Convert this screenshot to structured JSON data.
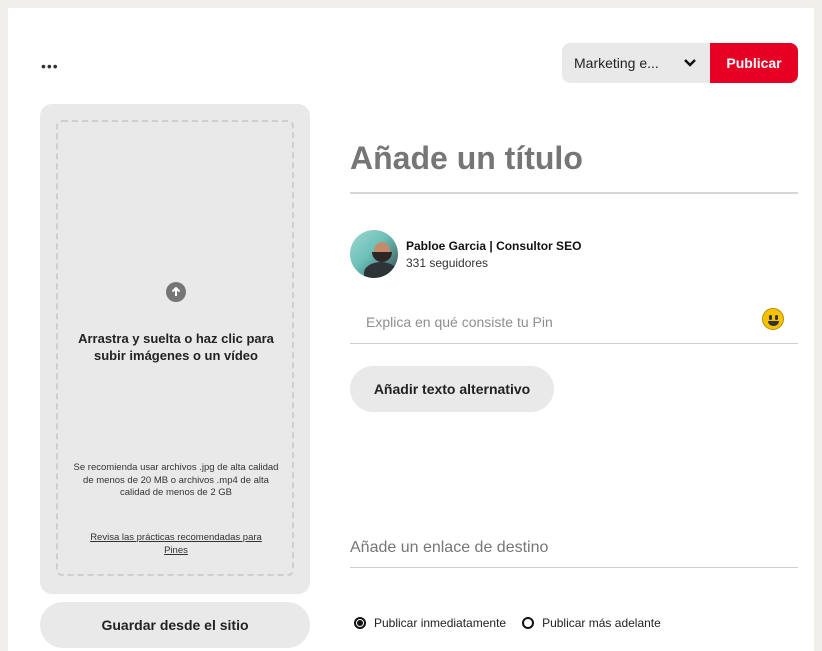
{
  "toolbar": {
    "more_label": "•••",
    "board_select": "Marketing e...",
    "publish_label": "Publicar",
    "publish_color": "#e60023"
  },
  "upload": {
    "icon": "arrow-up-icon",
    "drop_text": "Arrastra y suelta o haz clic para subir imágenes o un vídeo",
    "recommendation": "Se recomienda usar archivos .jpg de alta calidad de menos de 20 MB o archivos .mp4 de alta calidad de menos de 2 GB",
    "practices_link": "Revisa las prácticas recomendadas para Pines",
    "save_from_site": "Guardar desde el sitio"
  },
  "form": {
    "title_placeholder": "Añade un título",
    "user_name": "Pabloe Garcia | Consultor SEO",
    "followers": "331 seguidores",
    "description_placeholder": "Explica en qué consiste tu Pin",
    "alt_text_button": "Añadir texto alternativo",
    "link_placeholder": "Añade un enlace de destino",
    "publish_options": [
      {
        "label": "Publicar inmediatamente",
        "checked": true
      },
      {
        "label": "Publicar más adelante",
        "checked": false
      }
    ]
  }
}
